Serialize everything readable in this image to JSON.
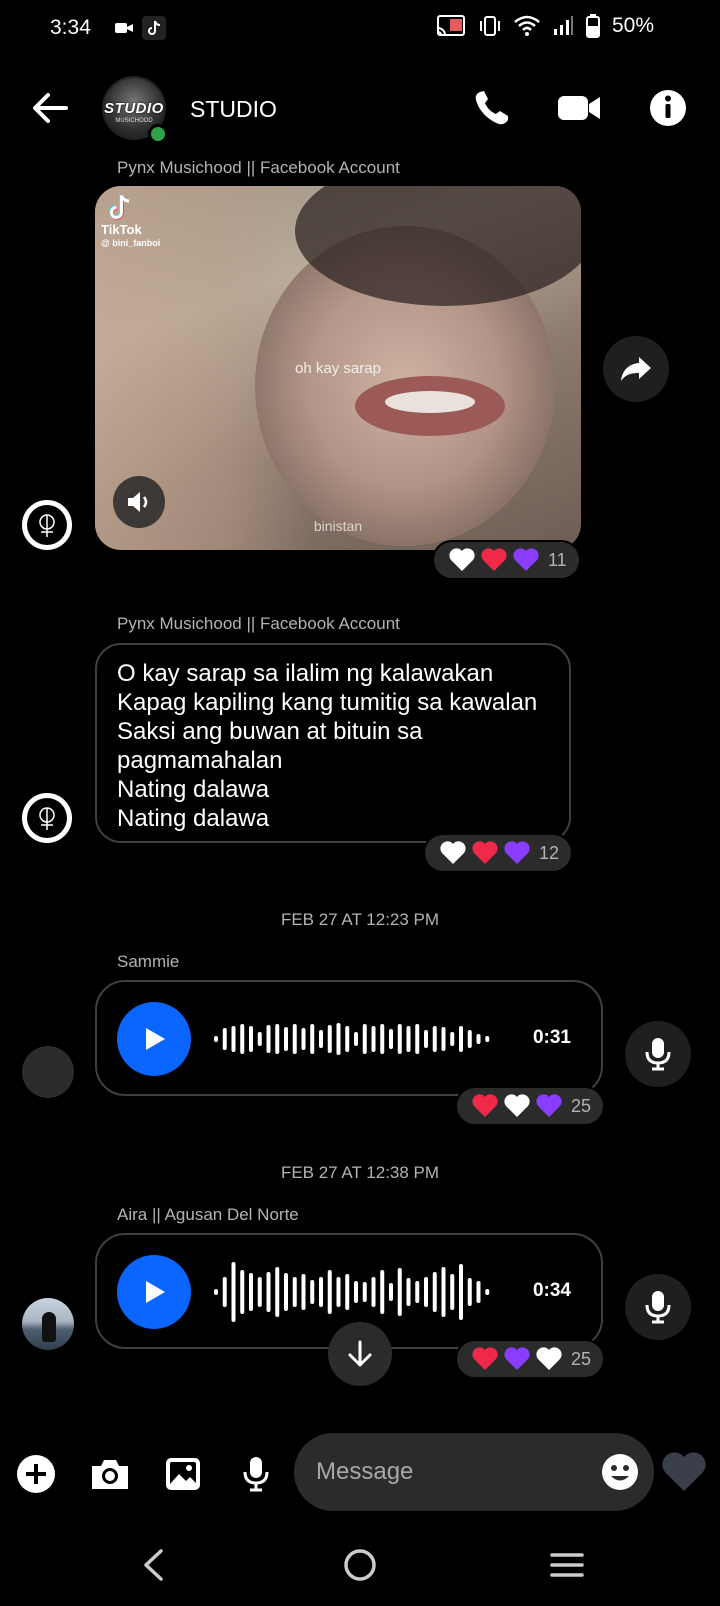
{
  "status_bar": {
    "time": "3:34",
    "battery": "50%"
  },
  "header": {
    "title": "STUDIO",
    "avatar_text": "STUDIO",
    "avatar_subtext": "MUSICHOOD"
  },
  "messages": [
    {
      "sender": "Pynx Musichood || Facebook Account",
      "video": {
        "app": "TikTok",
        "handle": "@ bini_fanboi",
        "caption": "oh kay sarap",
        "watermark": "binistan"
      },
      "reaction_count": "11"
    },
    {
      "sender": "Pynx Musichood || Facebook Account",
      "lines": [
        "O kay sarap sa ilalim ng kalawakan",
        "Kapag kapiling kang tumitig sa kawalan",
        "Saksi ang buwan at bituin sa",
        "pagmamahalan",
        "Nating dalawa",
        "Nating dalawa"
      ],
      "reaction_count": "12"
    },
    {
      "timestamp": "FEB 27 AT 12:23 PM",
      "sender": "Sammie",
      "duration": "0:31",
      "reaction_count": "25"
    },
    {
      "timestamp": "FEB 27 AT 12:38 PM",
      "sender": "Aira || Agusan Del Norte",
      "duration": "0:34",
      "reaction_count": "25"
    }
  ],
  "composer": {
    "placeholder": "Message"
  },
  "colors": {
    "accent": "#0a66ff",
    "online": "#31a24c",
    "bubble_border": "#3e4042",
    "purple_heart": "#8b3dff",
    "red_heart": "#f02849"
  }
}
